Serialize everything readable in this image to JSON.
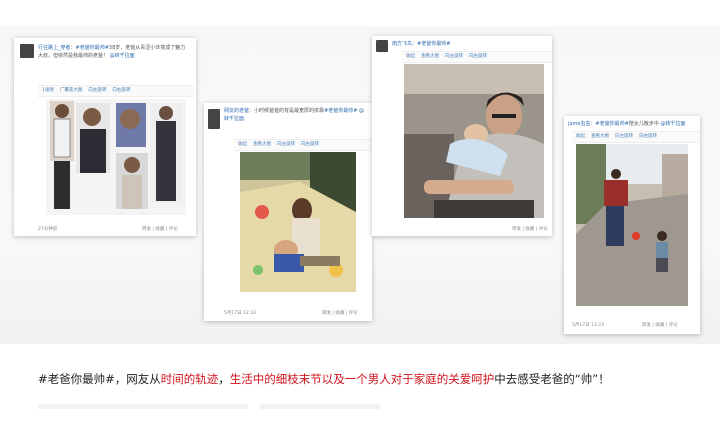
{
  "cards": [
    {
      "user": "行在路上_穿者",
      "topic": "#老爸你最帅#",
      "body": "38岁，老爸从青涩小伙变成了魅力大叔，但依然是我最帅的老爸！",
      "link": "@转千拉面",
      "toolbar": [
        "1张图",
        "广覆盖大图",
        "向左旋转",
        "向右旋转"
      ],
      "footer_left": "27分钟前",
      "footer_right": [
        "转发",
        "收藏",
        "评论"
      ]
    },
    {
      "user": "网友的老爸",
      "topic": "#老爸你最帅#",
      "body": "小时候爸爸的背是最宽厚的依靠",
      "link": "@转千拉面",
      "toolbar": [
        "收起",
        "查看大图",
        "向左旋转",
        "向右旋转"
      ],
      "footer_left": "5月17日 12:33",
      "footer_right": [
        "转发",
        "收藏",
        "评论"
      ]
    },
    {
      "user": "南方飞鸟",
      "topic": "#老爸你最帅#",
      "toolbar": [
        "收起",
        "查看大图",
        "向左旋转",
        "向右旋转"
      ],
      "footer_right": [
        "转发",
        "收藏",
        "评论"
      ]
    },
    {
      "user": "jame虫虫",
      "topic": "#老爸你最帅#",
      "body": "陪女儿散步中",
      "link": "@转千拉面",
      "toolbar": [
        "收起",
        "查看大图",
        "向左旋转",
        "向右旋转"
      ],
      "footer_left": "5月17日 13:23",
      "footer_right": [
        "转发",
        "收藏",
        "评论"
      ]
    }
  ],
  "caption": {
    "part1": "#老爸你最帅#，网友从",
    "hl1": "时间的轨迹",
    "part2": "，",
    "hl2": "生活中的细枝末节以及一个男人对于家庭的关爱呵护",
    "part3": "中去感受老爸的“帅”！"
  }
}
